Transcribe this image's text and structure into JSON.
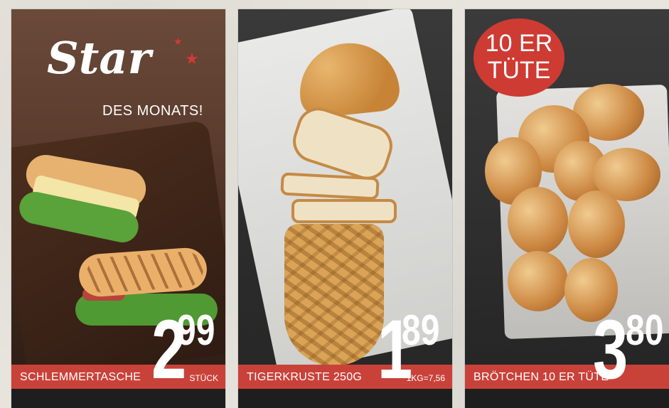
{
  "panels": [
    {
      "logo_title": "Star",
      "logo_subtitle": "DES MONATS!",
      "label": "SCHLEMMERTASCHE",
      "price_main": "2",
      "price_cents": "99",
      "unit_note": "STÜCK"
    },
    {
      "label": "TIGERKRUSTE 250G",
      "price_main": "1",
      "price_cents": "89",
      "unit_note": "1KG=7,56"
    },
    {
      "badge_line1": "10 ER",
      "badge_line2": "TÜTE",
      "label": "BRÖTCHEN 10 ER TÜTE",
      "price_main": "3",
      "price_cents": "80"
    }
  ],
  "colors": {
    "accent_red": "#c9423a",
    "badge_red": "#cd3b33"
  }
}
